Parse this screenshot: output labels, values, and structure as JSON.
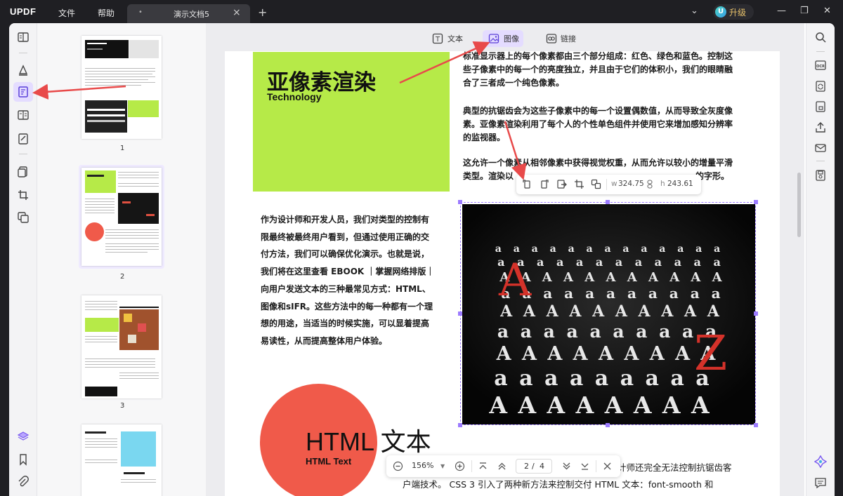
{
  "app": {
    "logo": "UPDF"
  },
  "menu": {
    "file": "文件",
    "help": "帮助"
  },
  "tab": {
    "title": "演示文档5",
    "modified_dot": "•",
    "close": "×"
  },
  "new_tab": "+",
  "upgrade": {
    "avatar": "U",
    "label": "升级"
  },
  "window": {
    "dropdown": "⌄",
    "minimize": "—",
    "restore": "❐",
    "close": "✕"
  },
  "toolbar": {
    "text": "文本",
    "image": "图像",
    "link": "链接"
  },
  "thumbnails": [
    {
      "num": "1"
    },
    {
      "num": "2"
    },
    {
      "num": "3"
    }
  ],
  "doc": {
    "title": "亚像素渲染",
    "subtitle": "Technology",
    "right_paras": [
      [
        "标准显示器上的每个像素都由三个部分组成：红色、绿色和蓝色。控制这",
        "些子像素中的每一个的亮度独立，并且由于它们的体积小，我们的眼睛融",
        "合了三者成一个纯色像素。"
      ],
      [
        "典型的抗锯齿会为这些子像素中的每一个设置偶数值，从而导致全灰度像",
        "素。亚像素渲染利用了每个人的个性单色组件并使用它来增加感知分辨率",
        "的监视器。"
      ],
      [
        "这允许一个像素从相邻像素中获得视觉权重，从而允许以较小的增量平滑",
        "类型。渲染以                                                              的字形。"
      ]
    ],
    "left_para": [
      "作为设计师和开发人员，我们对类型的控制有",
      "限最终被最终用户看到，但通过使用正确的交",
      "付方法，我们可以确保优化演示。也就是说，",
      "我们将在这里查看 EBOOK ｜掌握网络排版｜",
      "向用户发送文本的三种最常见方式：HTML、",
      "图像和sIFR。这些方法中的每一种都有一个理",
      "想的用途，当适当的时候实施，可以显着提高",
      "易读性，从而提高整体用户体验。"
    ],
    "circle_title": "HTML 文本",
    "circle_subtitle": "HTML Text",
    "bottom_lines": [
      "计师还完全无法控制抗锯齿客",
      "户端技术。 CSS 3 引入了两种新方法来控制交付 HTML 文本：font-smooth 和"
    ]
  },
  "image_toolbar": {
    "w_label": "w",
    "w_value": "324.75",
    "h_label": "h",
    "h_value": "243.61"
  },
  "page_nav": {
    "zoom": "156%",
    "current_page": "2",
    "separator": "/",
    "total_pages": "4"
  },
  "colors": {
    "accent": "#8b6cff",
    "green_block": "#b6ea48",
    "circle": "#f05a4a",
    "arrow": "#e84a4a",
    "upgrade": "#e6c06a"
  }
}
